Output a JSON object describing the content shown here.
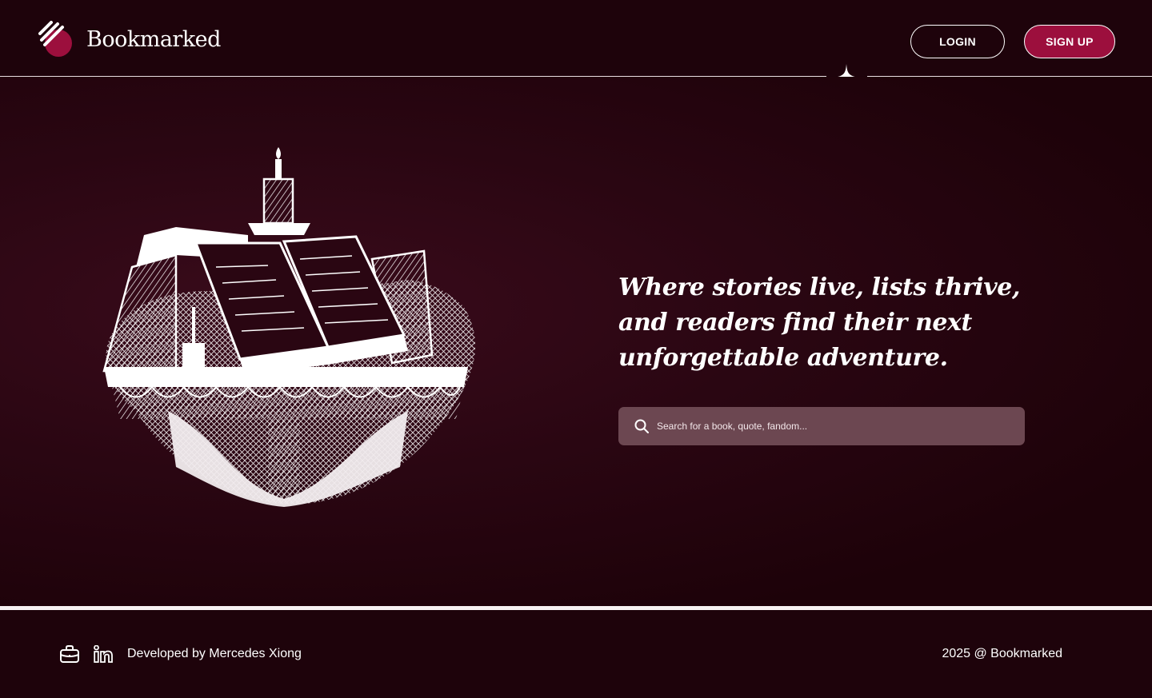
{
  "header": {
    "brand": "Bookmarked",
    "login_label": "LOGIN",
    "signup_label": "SIGN UP"
  },
  "hero": {
    "tagline": "Where stories live, lists thrive, and readers find their next unforgettable adventure.",
    "search": {
      "placeholder": "Search for a book, quote, fandom...",
      "value": ""
    },
    "illustration_icon": "open-book-with-candle-illustration"
  },
  "footer": {
    "credit": "Developed by Mercedes Xiong",
    "copyright": "2025 @ Bookmarked",
    "icons": [
      "briefcase-icon",
      "linkedin-icon"
    ]
  },
  "colors": {
    "background": "#1e030b",
    "accent": "#9c0f3d",
    "search_bg": "#6c4751",
    "text": "#ffffff"
  }
}
